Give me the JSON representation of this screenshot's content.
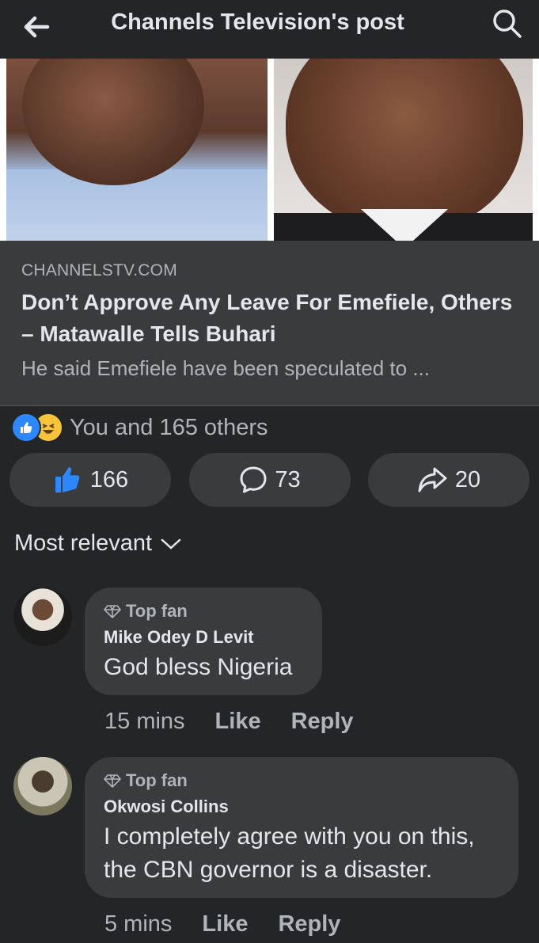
{
  "header": {
    "title": "Channels Television's post"
  },
  "link_preview": {
    "domain": "CHANNELSTV.COM",
    "headline": "Don’t Approve Any Leave For Emefiele, Others – Matawalle Tells Buhari",
    "description": "He said Emefiele have been speculated to ..."
  },
  "reactions": {
    "summary": "You and 165 others"
  },
  "actions": {
    "like_count": "166",
    "comment_count": "73",
    "share_count": "20"
  },
  "sort": {
    "label": "Most relevant"
  },
  "comments": [
    {
      "badge": "Top fan",
      "author": "Mike Odey D Levit",
      "text": "God bless Nigeria",
      "time": "15 mins",
      "like": "Like",
      "reply": "Reply"
    },
    {
      "badge": "Top fan",
      "author": "Okwosi Collins",
      "text": "I completely agree with you on this, the CBN governor is a disaster.",
      "time": "5 mins",
      "like": "Like",
      "reply": "Reply"
    }
  ],
  "colors": {
    "background": "#242526",
    "surface": "#3a3b3c",
    "like_blue": "#2d88ff",
    "text_primary": "#e4e6eb",
    "text_secondary": "#b0b3b8"
  },
  "icons": [
    "back-arrow-icon",
    "search-icon",
    "like-reaction-icon",
    "haha-reaction-icon",
    "thumbs-up-icon",
    "comment-icon",
    "share-icon",
    "chevron-down-icon",
    "diamond-icon"
  ]
}
